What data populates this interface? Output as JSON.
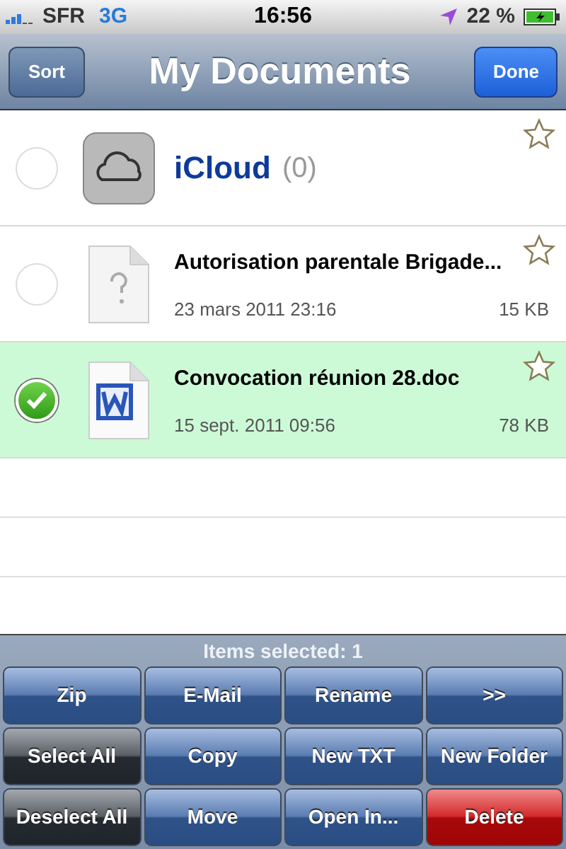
{
  "status_bar": {
    "carrier": "SFR",
    "network": "3G",
    "time": "16:56",
    "battery_percent": "22 %"
  },
  "nav_bar": {
    "left_button": "Sort",
    "title": "My Documents",
    "right_button": "Done"
  },
  "items": [
    {
      "kind": "cloud",
      "name": "iCloud",
      "count": "(0)",
      "selected": false
    },
    {
      "kind": "unknown",
      "name": "Autorisation parentale Brigade...",
      "date": "23 mars 2011 23:16",
      "size": "15 KB",
      "selected": false
    },
    {
      "kind": "word",
      "name": "Convocation réunion 28.doc",
      "date": "15 sept. 2011 09:56",
      "size": "78 KB",
      "selected": true
    }
  ],
  "toolbar": {
    "status": "Items selected: 1",
    "buttons": [
      {
        "label": "Zip",
        "kind": "blue"
      },
      {
        "label": "E-Mail",
        "kind": "blue"
      },
      {
        "label": "Rename",
        "kind": "blue"
      },
      {
        "label": ">>",
        "kind": "blue"
      },
      {
        "label": "Select All",
        "kind": "dark"
      },
      {
        "label": "Copy",
        "kind": "blue"
      },
      {
        "label": "New TXT",
        "kind": "blue"
      },
      {
        "label": "New Folder",
        "kind": "blue"
      },
      {
        "label": "Deselect All",
        "kind": "dark"
      },
      {
        "label": "Move",
        "kind": "blue"
      },
      {
        "label": "Open In...",
        "kind": "blue"
      },
      {
        "label": "Delete",
        "kind": "red"
      }
    ]
  }
}
